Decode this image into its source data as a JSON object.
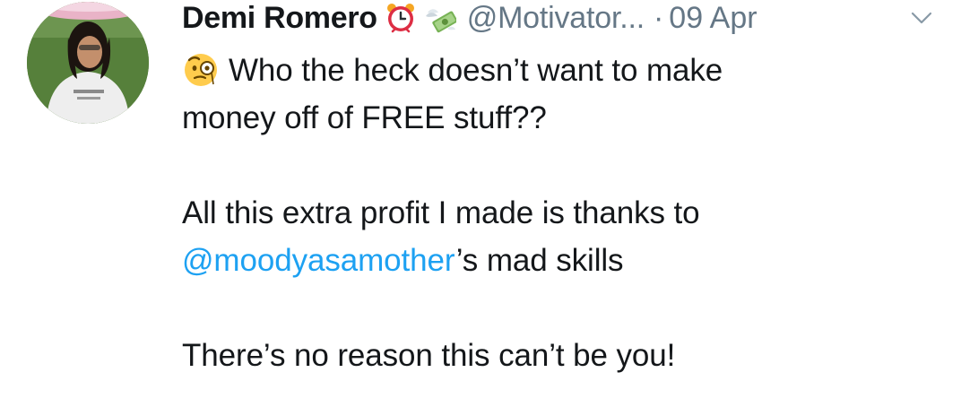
{
  "tweet": {
    "author_name": "Demi Romero",
    "handle": "@Motivator...",
    "separator": "·",
    "date": "09 Apr",
    "badges": [
      "alarm-clock-icon",
      "money-with-wings-icon"
    ],
    "inline_emoji": "face-with-monocle-icon",
    "lines": [
      "Who the heck doesn’t want to make",
      "money off of FREE stuff??",
      "All this extra profit I made is thanks to",
      "’s mad skills",
      "There’s no reason this can’t be you!"
    ],
    "mention": "@moodyasamother"
  },
  "colors": {
    "text": "#14171a",
    "muted": "#657786",
    "link": "#1da1f2"
  }
}
